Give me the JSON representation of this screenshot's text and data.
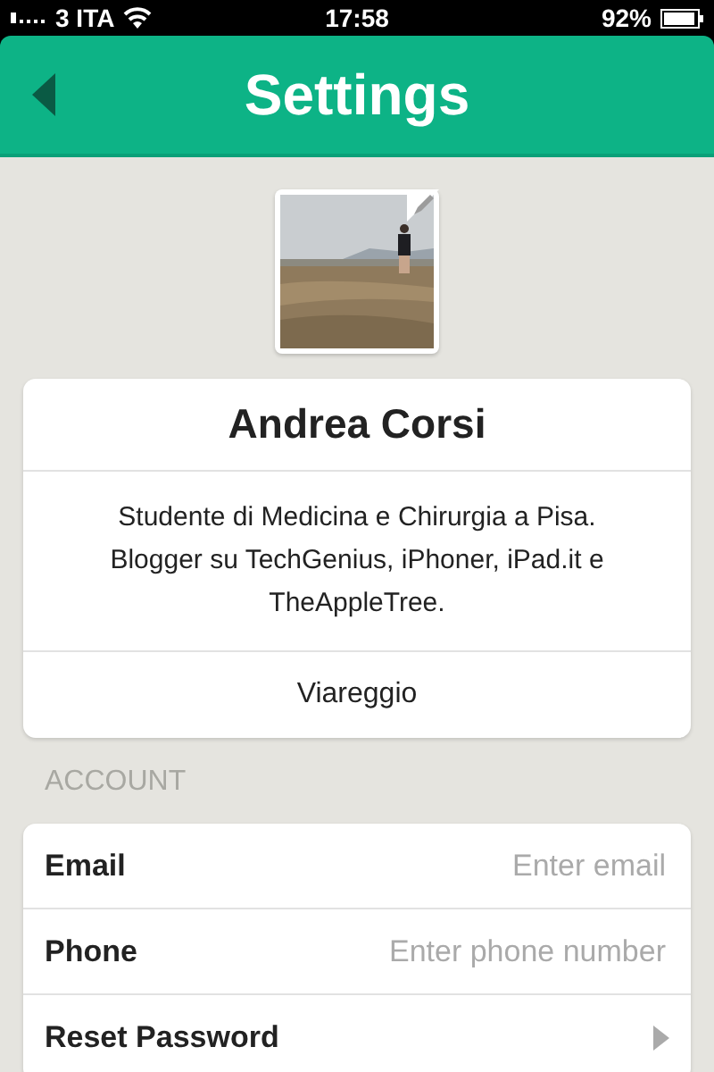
{
  "status_bar": {
    "carrier": "3 ITA",
    "time": "17:58",
    "battery": "92%"
  },
  "nav_bar": {
    "title": "Settings"
  },
  "profile": {
    "name": "Andrea Corsi",
    "bio": "Studente di Medicina e Chirurgia a Pisa. Blogger su TechGenius, iPhoner, iPad.it e TheAppleTree.",
    "location": "Viareggio"
  },
  "account": {
    "heading": "ACCOUNT",
    "rows": [
      {
        "kind": "field",
        "label": "Email",
        "placeholder": "Enter email"
      },
      {
        "kind": "field",
        "label": "Phone",
        "placeholder": "Enter phone number"
      },
      {
        "kind": "link",
        "label": "Reset Password"
      }
    ]
  }
}
